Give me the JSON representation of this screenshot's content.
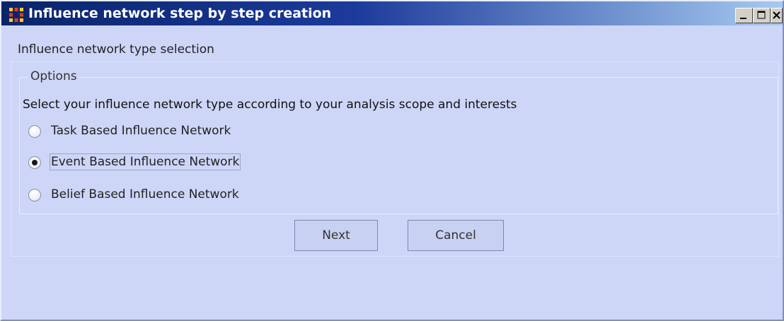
{
  "window": {
    "title": "Influence network step by step creation",
    "controls": [
      "minimize",
      "maximize",
      "close"
    ]
  },
  "page": {
    "section_title": "Influence network type selection",
    "options_legend": "Options",
    "instruction": "Select your influence network type according to your analysis scope and interests"
  },
  "options": [
    {
      "label": "Task Based Influence Network",
      "selected": false
    },
    {
      "label": "Event Based Influence Network",
      "selected": true
    },
    {
      "label": "Belief Based Influence Network",
      "selected": false
    }
  ],
  "buttons": {
    "next": "Next",
    "cancel": "Cancel"
  },
  "colors": {
    "titlebar_start": "#0a246a",
    "titlebar_end": "#a6caf0",
    "window_background": "#cdd6f7"
  },
  "icons": {
    "app": "network-grid-icon",
    "minimize": "minimize-icon",
    "maximize": "maximize-icon",
    "close": "close-icon"
  }
}
